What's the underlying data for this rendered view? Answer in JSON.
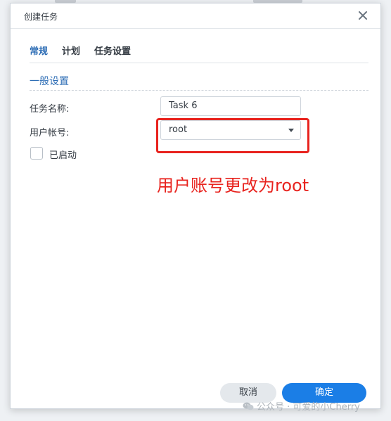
{
  "dialog": {
    "title": "创建任务"
  },
  "tabs": [
    {
      "label": "常规",
      "active": true
    },
    {
      "label": "计划",
      "active": false
    },
    {
      "label": "任务设置",
      "active": false
    }
  ],
  "general": {
    "section_title": "一般设置",
    "task_name_label": "任务名称:",
    "task_name_value": "Task 6",
    "user_label": "用户帐号:",
    "user_value": "root",
    "enabled_label": "已启动",
    "enabled": false
  },
  "annotation": {
    "text": "用户账号更改为root",
    "color": "#e8231e"
  },
  "footer": {
    "cancel_label": "取消",
    "ok_label": "确定"
  },
  "watermark": {
    "text": "公众号 · 可爱的小Cherry"
  },
  "colors": {
    "accent": "#1b7ee6",
    "tab_active": "#2d6db5",
    "highlight": "#e8231e"
  },
  "icons": {
    "close": "close-icon",
    "dropdown": "chevron-down-icon",
    "watermark": "wechat-icon"
  }
}
